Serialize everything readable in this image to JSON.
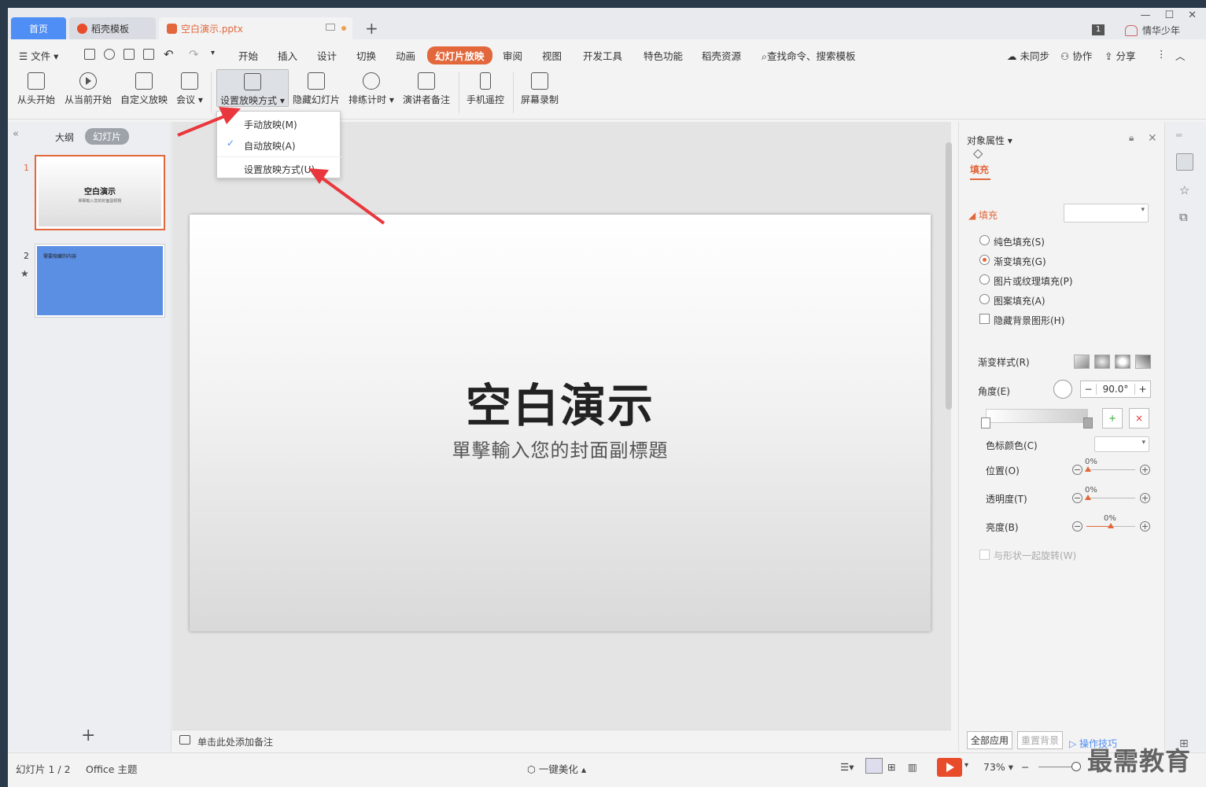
{
  "titlebar": {
    "tabs": [
      {
        "label": "首页"
      },
      {
        "label": "稻壳模板"
      },
      {
        "label": "空白演示.pptx"
      }
    ],
    "page_badge": "1",
    "user": "情华少年"
  },
  "menu": {
    "file": "文件",
    "items": [
      "开始",
      "插入",
      "设计",
      "切换",
      "动画",
      "幻灯片放映",
      "审阅",
      "视图",
      "开发工具",
      "特色功能",
      "稻壳资源"
    ],
    "active": "幻灯片放映",
    "search": "查找命令、搜索模板",
    "sync": "未同步",
    "collab": "协作",
    "share": "分享"
  },
  "ribbon": {
    "buttons": [
      "从头开始",
      "从当前开始",
      "自定义放映",
      "会议",
      "设置放映方式",
      "隐藏幻灯片",
      "排练计时",
      "演讲者备注",
      "手机遥控",
      "屏幕录制"
    ]
  },
  "dropdown": {
    "items": [
      "手动放映(M)",
      "自动放映(A)",
      "设置放映方式(U)"
    ],
    "checked": "自动放映(A)"
  },
  "left_panel": {
    "tab_outline": "大纲",
    "tab_slides": "幻灯片",
    "slides": [
      {
        "number": "1",
        "title": "空白演示",
        "subtitle": "單擊輸入您的封面副標題"
      },
      {
        "number": "2",
        "title": "需要隐藏的内容"
      }
    ]
  },
  "slide": {
    "title": "空白演示",
    "subtitle": "單擊輸入您的封面副標題"
  },
  "notes": {
    "placeholder": "单击此处添加备注"
  },
  "properties": {
    "header": "对象属性",
    "tab": "填充",
    "section": "填充",
    "fill_options": [
      "纯色填充(S)",
      "渐变填充(G)",
      "图片或纹理填充(P)",
      "图案填充(A)"
    ],
    "selected_fill": "渐变填充(G)",
    "hide_bg": "隐藏背景图形(H)",
    "gradient_style": "渐变样式(R)",
    "angle_label": "角度(E)",
    "angle_value": "90.0°",
    "stop_color": "色标颜色(C)",
    "position": {
      "label": "位置(O)",
      "value": "0%"
    },
    "transparency": {
      "label": "透明度(T)",
      "value": "0%"
    },
    "brightness": {
      "label": "亮度(B)",
      "value": "0%"
    },
    "rotate_with_shape": "与形状一起旋转(W)",
    "apply_all": "全部应用",
    "reset_bg": "重置背景",
    "tips": "操作技巧"
  },
  "status": {
    "slide_counter": "幻灯片 1 / 2",
    "theme": "Office 主题",
    "beautify": "一键美化",
    "zoom": "73%"
  },
  "watermark": "最需教育",
  "colors": {
    "accent": "#e2673b",
    "tab_home": "#4e8ef5",
    "slide2_bg": "#5b8fe4",
    "play": "#e84c2b",
    "arrow": "#e8383d"
  }
}
